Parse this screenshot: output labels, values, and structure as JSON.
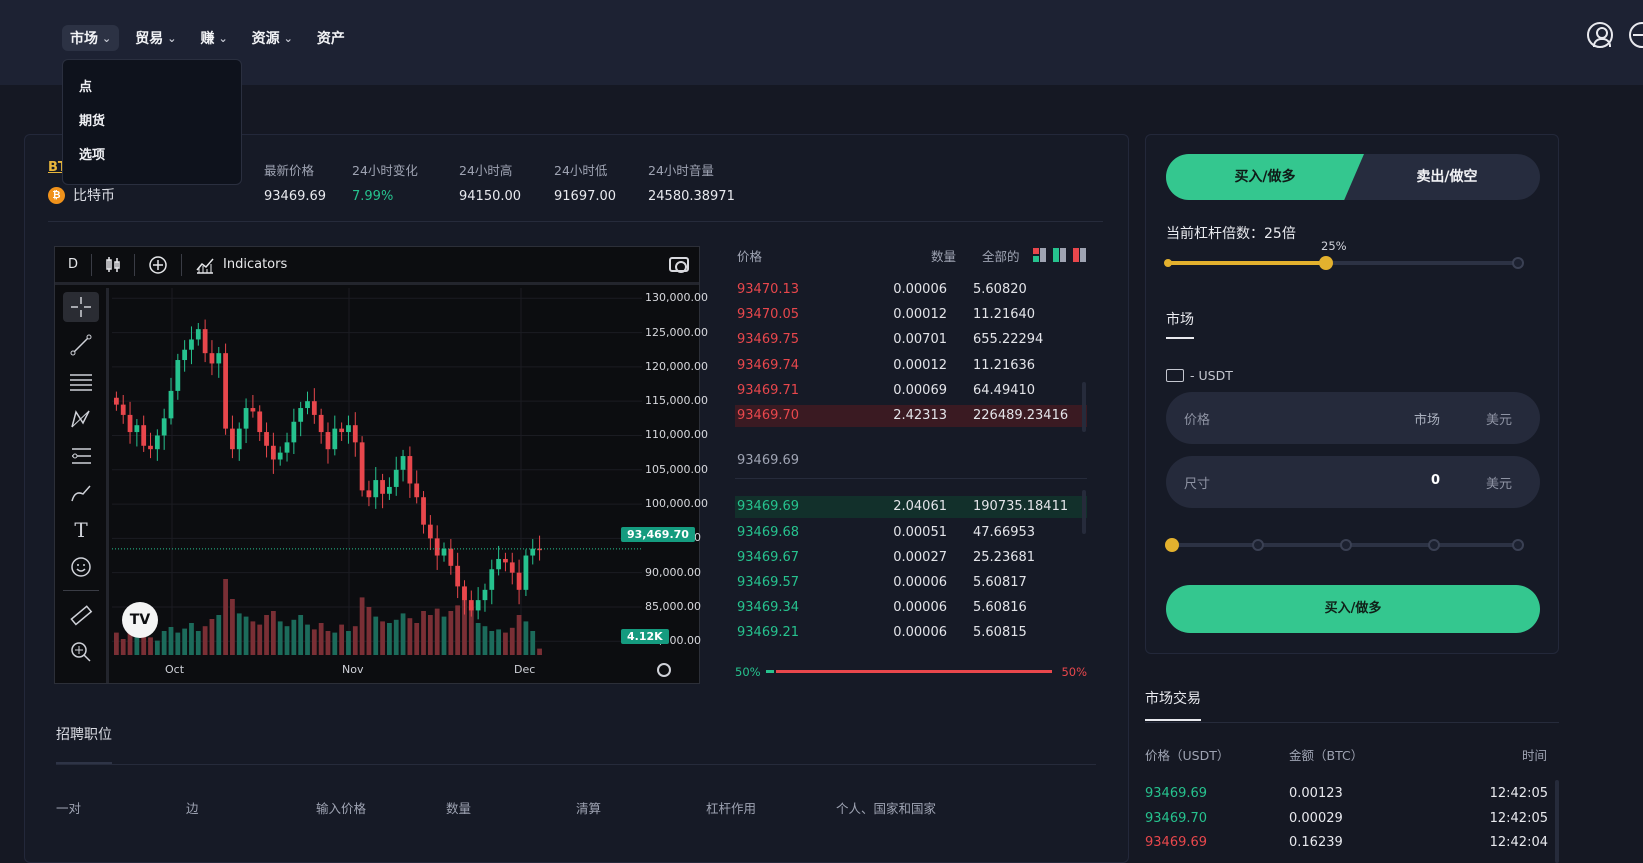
{
  "nav": {
    "items": [
      {
        "label": "市场",
        "has_menu": true,
        "active": true
      },
      {
        "label": "贸易",
        "has_menu": true
      },
      {
        "label": "赚",
        "has_menu": true
      },
      {
        "label": "资源",
        "has_menu": true
      },
      {
        "label": "资产",
        "has_menu": false
      }
    ],
    "dropdown": [
      "点",
      "期货",
      "选项"
    ]
  },
  "header_icons": [
    "user-icon",
    "globe-icon"
  ],
  "ticker": {
    "pair": "BTC",
    "coin_name": "比特币",
    "coin_symbol": "₿",
    "stats": [
      {
        "label": "最新价格",
        "value": "93469.69"
      },
      {
        "label": "24小时变化",
        "value": "7.99%",
        "up": true
      },
      {
        "label": "24小时高",
        "value": "94150.00"
      },
      {
        "label": "24小时低",
        "value": "91697.00"
      },
      {
        "label": "24小时音量",
        "value": "24580.38971"
      }
    ]
  },
  "chart_toolbar": {
    "interval": "D",
    "indicators": "Indicators"
  },
  "chart_data": {
    "type": "candlestick",
    "y_ticks": [
      "130,000.00",
      "125,000.00",
      "120,000.00",
      "115,000.00",
      "110,000.00",
      "105,000.00",
      "100,000.00",
      "95,000.00",
      "90,000.00",
      "85,000.00",
      "80,000.00"
    ],
    "x_ticks": [
      "Oct",
      "Nov",
      "Dec"
    ],
    "ylim": [
      78000,
      131500
    ],
    "last_price_label": "93,469.70",
    "volume_label": "4.12K",
    "closes": [
      114500,
      113000,
      110500,
      111500,
      108500,
      108000,
      110000,
      112500,
      116500,
      121000,
      122500,
      124000,
      125500,
      122000,
      120500,
      122000,
      111000,
      108000,
      111000,
      114000,
      113500,
      110500,
      108500,
      106500,
      107500,
      109000,
      112000,
      114000,
      115000,
      113000,
      110500,
      108000,
      111000,
      110500,
      111500,
      109000,
      102000,
      101000,
      103500,
      101500,
      102500,
      105000,
      107000,
      103000,
      101000,
      97000,
      95000,
      92500,
      93500,
      91000,
      88000,
      86000,
      84500,
      86000,
      87500,
      90500,
      92000,
      91500,
      90000,
      87500,
      92500,
      93500,
      93470
    ],
    "volume_heights": [
      0.28,
      0.2,
      0.32,
      0.25,
      0.3,
      0.22,
      0.18,
      0.3,
      0.35,
      0.28,
      0.33,
      0.4,
      0.3,
      0.36,
      0.45,
      0.5,
      0.95,
      0.7,
      0.52,
      0.48,
      0.42,
      0.38,
      0.5,
      0.55,
      0.42,
      0.36,
      0.44,
      0.5,
      0.38,
      0.32,
      0.4,
      0.3,
      0.28,
      0.38,
      0.3,
      0.36,
      0.72,
      0.6,
      0.48,
      0.42,
      0.4,
      0.44,
      0.52,
      0.46,
      0.4,
      0.55,
      0.5,
      0.58,
      0.48,
      0.55,
      0.62,
      0.85,
      0.6,
      0.4,
      0.36,
      0.3,
      0.32,
      0.28,
      0.34,
      0.5,
      0.42,
      0.3,
      0.08
    ]
  },
  "orderbook": {
    "headers": {
      "price": "价格",
      "qty": "数量",
      "total": "全部的"
    },
    "asks": [
      {
        "p": "93470.13",
        "q": "0.00006",
        "t": "5.60820"
      },
      {
        "p": "93470.05",
        "q": "0.00012",
        "t": "11.21640"
      },
      {
        "p": "93469.75",
        "q": "0.00701",
        "t": "655.22294"
      },
      {
        "p": "93469.74",
        "q": "0.00012",
        "t": "11.21636"
      },
      {
        "p": "93469.71",
        "q": "0.00069",
        "t": "64.49410"
      },
      {
        "p": "93469.70",
        "q": "2.42313",
        "t": "226489.23416"
      }
    ],
    "mid": "93469.69",
    "bids": [
      {
        "p": "93469.69",
        "q": "2.04061",
        "t": "190735.18411"
      },
      {
        "p": "93469.68",
        "q": "0.00051",
        "t": "47.66953"
      },
      {
        "p": "93469.67",
        "q": "0.00027",
        "t": "25.23681"
      },
      {
        "p": "93469.57",
        "q": "0.00006",
        "t": "5.60817"
      },
      {
        "p": "93469.34",
        "q": "0.00006",
        "t": "5.60816"
      },
      {
        "p": "93469.21",
        "q": "0.00006",
        "t": "5.60815"
      }
    ],
    "buy_ratio": "50%",
    "sell_ratio": "50%"
  },
  "order_form": {
    "buy_tab": "买入/做多",
    "sell_tab": "卖出/做空",
    "leverage_label": "当前杠杆倍数：25倍",
    "leverage_pct": "25%",
    "leverage_fraction": 0.45,
    "type_label": "市场",
    "balance": "- USDT",
    "price_field": {
      "label": "价格",
      "value": "市场",
      "unit": "美元"
    },
    "size_field": {
      "label": "尺寸",
      "value": "0",
      "unit": "美元"
    },
    "submit": "买入/做多"
  },
  "trades": {
    "title": "市场交易",
    "headers": {
      "price": "价格（USDT）",
      "amount": "金额（BTC）",
      "time": "时间"
    },
    "rows": [
      {
        "p": "93469.69",
        "a": "0.00123",
        "t": "12:42:05",
        "side": "buy"
      },
      {
        "p": "93469.70",
        "a": "0.00029",
        "t": "12:42:05",
        "side": "buy"
      },
      {
        "p": "93469.69",
        "a": "0.16239",
        "t": "12:42:04",
        "side": "sell"
      }
    ]
  },
  "positions": {
    "title": "招聘职位",
    "columns": [
      "一对",
      "边",
      "输入价格",
      "数量",
      "清算",
      "杠杆作用",
      "个人、国家和国家"
    ]
  },
  "colors": {
    "up": "#26c28e",
    "down": "#e8474c",
    "accent": "#34c78f",
    "leverage": "#e3b12e"
  }
}
